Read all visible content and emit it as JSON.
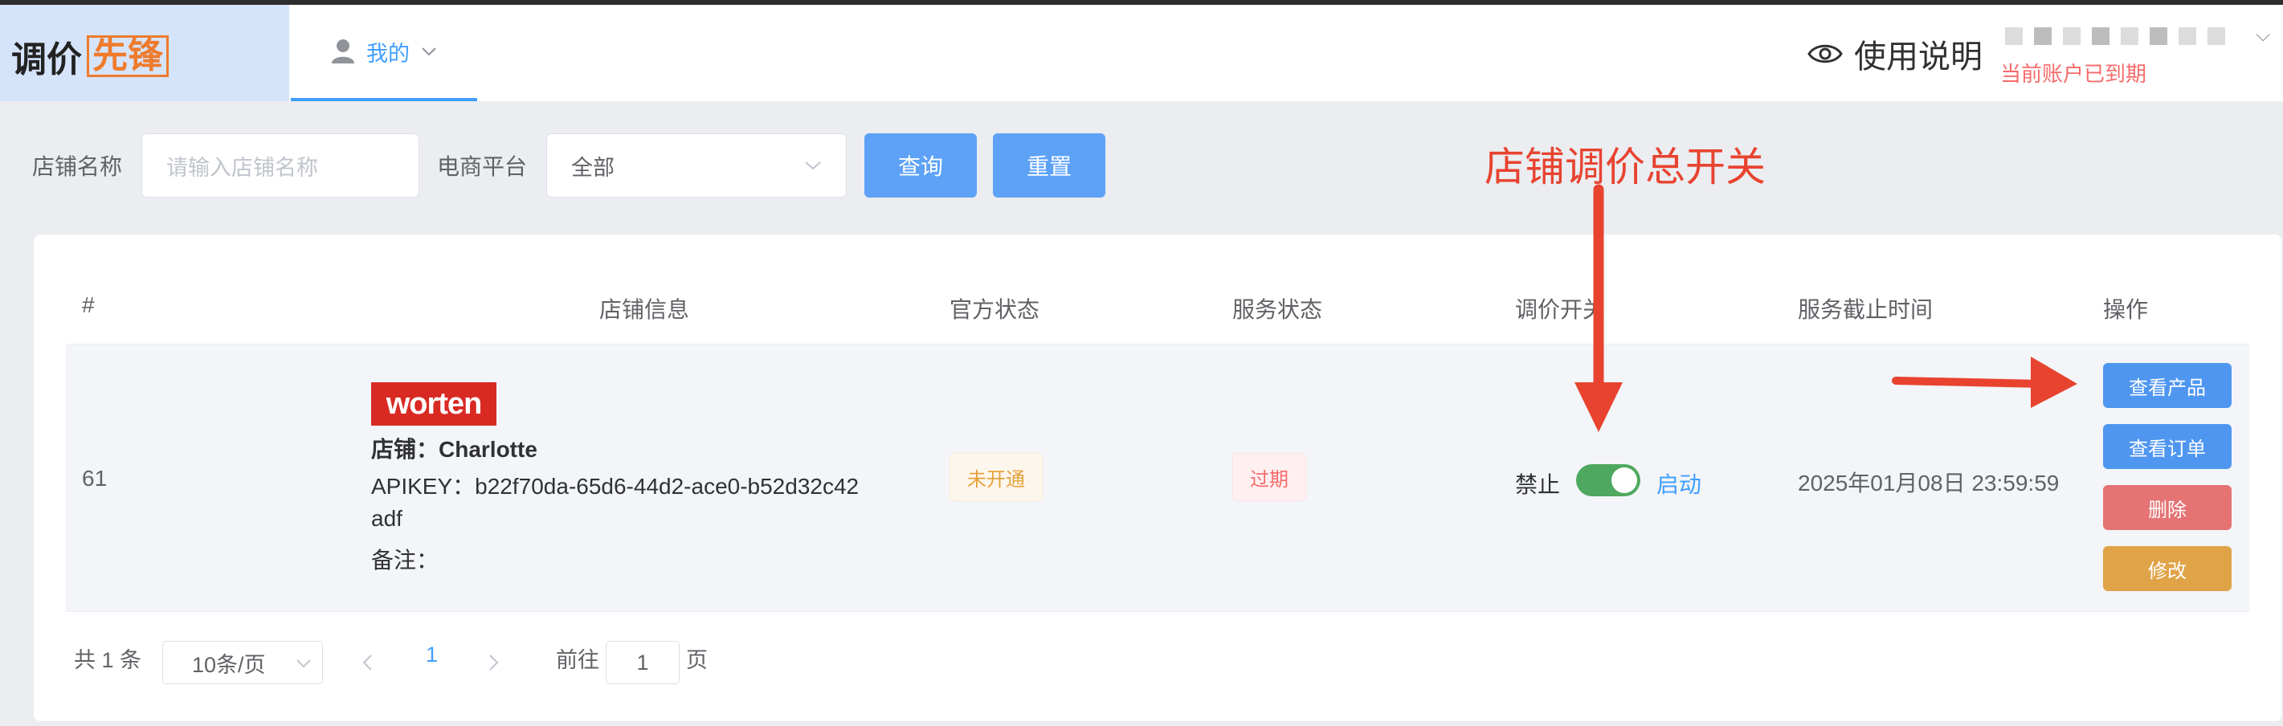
{
  "header": {
    "logo_main": "调价",
    "logo_highlight": "先锋",
    "menu_my": "我的",
    "help": "使用说明",
    "account_status": "当前账户已到期"
  },
  "filter": {
    "shop_name_label": "店铺名称",
    "shop_name_placeholder": "请输入店铺名称",
    "platform_label": "电商平台",
    "platform_value": "全部",
    "query_button": "查询",
    "reset_button": "重置"
  },
  "annotation": {
    "text": "店铺调价总开关"
  },
  "table": {
    "columns": [
      "#",
      "店铺信息",
      "官方状态",
      "服务状态",
      "调价开关",
      "服务截止时间",
      "操作"
    ],
    "rows": [
      {
        "index": "61",
        "logo": "worten",
        "shop_label": "店铺：Charlotte",
        "apikey_line1": "APIKEY：b22f70da-65d6-44d2-ace0-b52d32c42",
        "apikey_line2": "adf",
        "note": "备注：",
        "official_status": "未开通",
        "service_status": "过期",
        "switch_off_label": "禁止",
        "switch_on_label": "启动",
        "switch_on": true,
        "deadline": "2025年01月08日 23:59:59",
        "actions": {
          "view_products": "查看产品",
          "view_orders": "查看订单",
          "delete": "删除",
          "edit": "修改"
        }
      }
    ]
  },
  "pagination": {
    "total": "共 1 条",
    "page_size": "10条/页",
    "current_page": "1",
    "goto_label": "前往",
    "goto_value": "1",
    "page_suffix": "页"
  },
  "colors": {
    "primary": "#409eff",
    "button_blue": "#5da2f7",
    "danger": "#e57373",
    "warning": "#e0a347",
    "annotation_red": "#e8432f",
    "switch_green": "#4ea85f"
  }
}
